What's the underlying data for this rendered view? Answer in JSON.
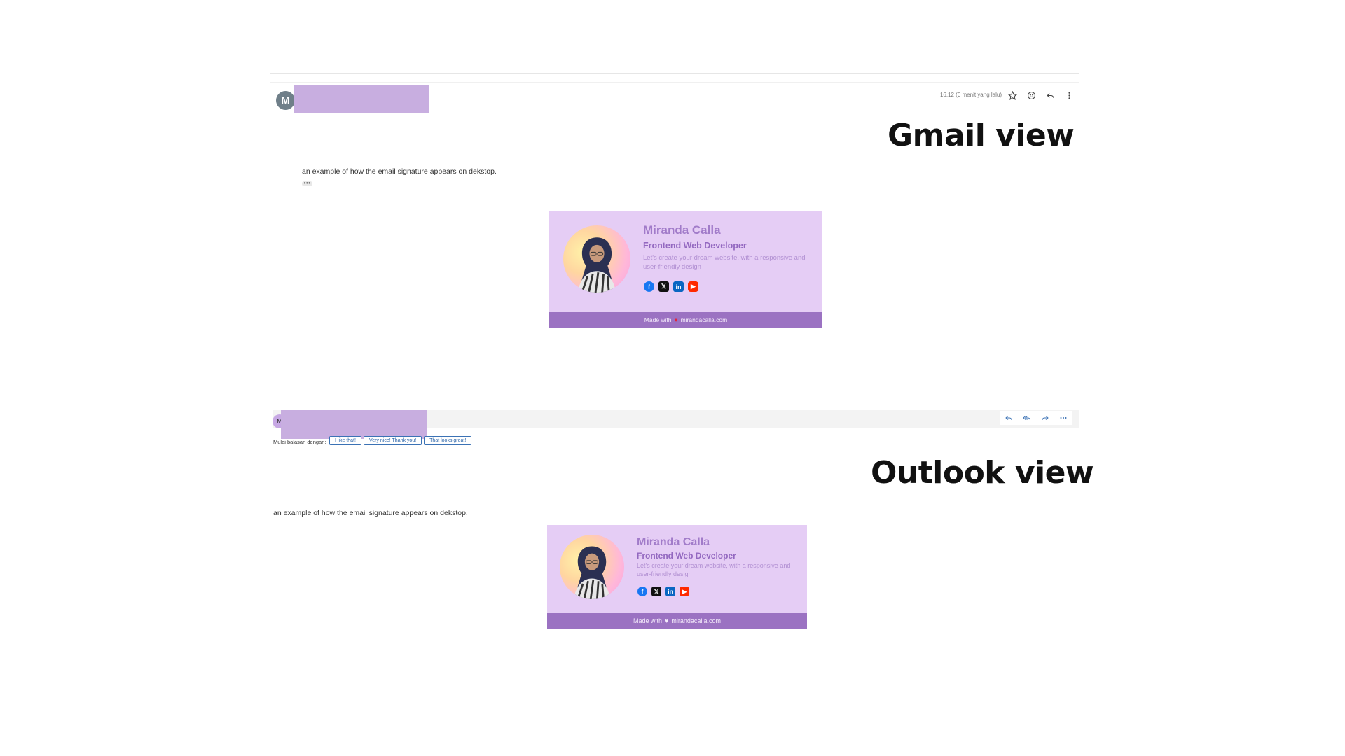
{
  "gmail": {
    "label": "Gmail view",
    "avatar_letter": "M",
    "timestamp": "16.12 (0 menit yang lalu)",
    "body_text": "an example of how the email signature appears on dekstop.",
    "more_text": "•••"
  },
  "outlook": {
    "label": "Outlook view",
    "avatar_letter": "M",
    "reply_label": "Mulai balasan dengan:",
    "quick_replies": [
      "I like that!",
      "Very nice! Thank you!",
      "That looks great!"
    ],
    "body_text": "an example of how the email signature appears on dekstop."
  },
  "signature": {
    "name": "Miranda Calla",
    "title": "Frontend Web Developer",
    "description": "Let's create your dream website, with a responsive and user-friendly design",
    "footer_prefix": "Made with",
    "footer_heart": "♥",
    "footer_link": "mirandacalla.com",
    "socials": [
      "facebook-icon",
      "x-icon",
      "linkedin-icon",
      "youtube-icon"
    ],
    "colors": {
      "card_bg": "#e5cdf5",
      "footer_bg": "#9b72c2",
      "name": "#a17bc9",
      "title": "#9368c0"
    }
  }
}
